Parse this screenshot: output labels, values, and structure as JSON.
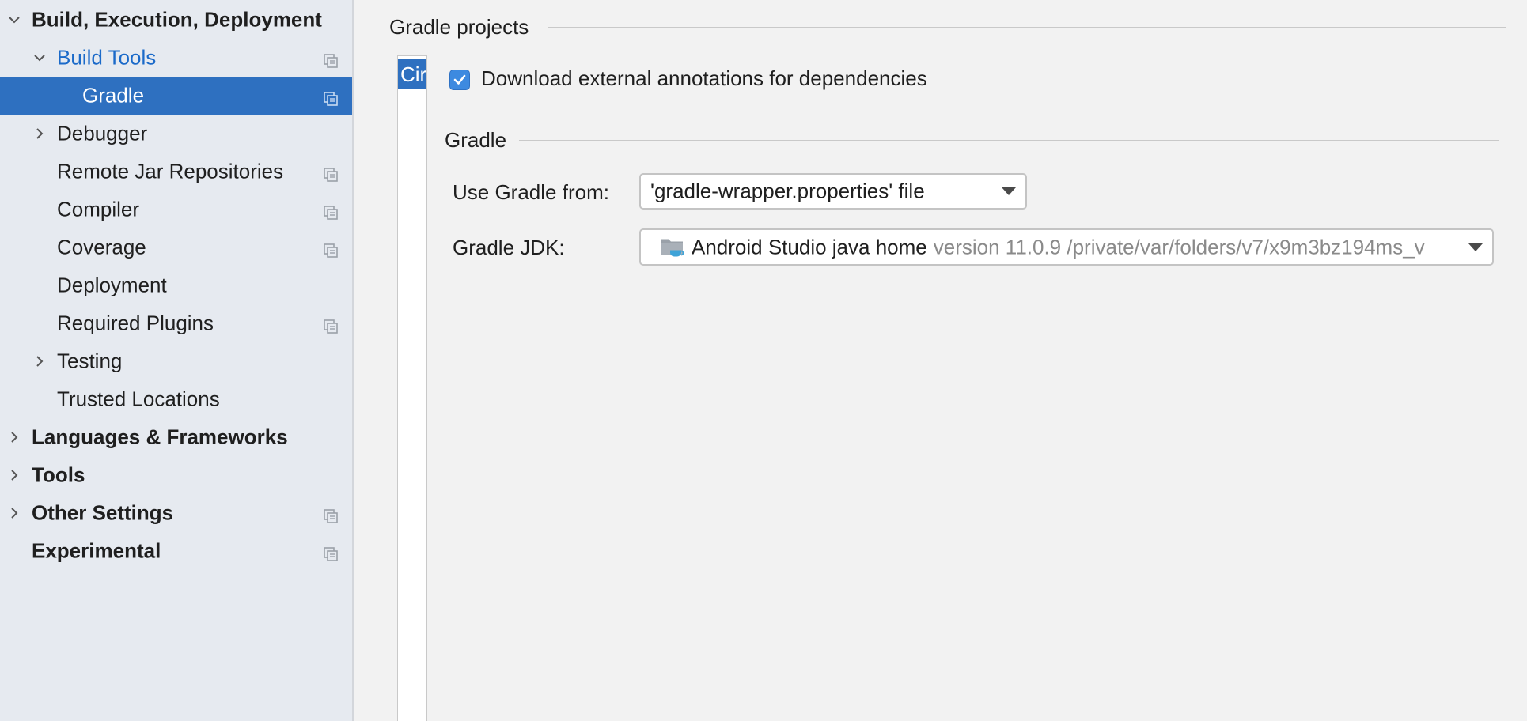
{
  "sidebar": {
    "items": [
      {
        "label": "Build, Execution, Deployment",
        "expanded": true
      },
      {
        "label": "Build Tools",
        "expanded": true
      },
      {
        "label": "Gradle",
        "selected": true
      },
      {
        "label": "Debugger",
        "expanded": false
      },
      {
        "label": "Remote Jar Repositories"
      },
      {
        "label": "Compiler"
      },
      {
        "label": "Coverage"
      },
      {
        "label": "Deployment"
      },
      {
        "label": "Required Plugins"
      },
      {
        "label": "Testing",
        "expanded": false
      },
      {
        "label": "Trusted Locations"
      },
      {
        "label": "Languages & Frameworks",
        "expanded": false
      },
      {
        "label": "Tools",
        "expanded": false
      },
      {
        "label": "Other Settings",
        "expanded": false
      },
      {
        "label": "Experimental"
      }
    ]
  },
  "main": {
    "gradle_projects_title": "Gradle projects",
    "project_list": {
      "selected_item": "Cir"
    },
    "download_annotations": {
      "label": "Download external annotations for dependencies",
      "checked": true
    },
    "gradle_section_title": "Gradle",
    "use_gradle_from": {
      "label": "Use Gradle from:",
      "value": "'gradle-wrapper.properties' file"
    },
    "gradle_jdk": {
      "label": "Gradle JDK:",
      "name": "Android Studio java home",
      "details": "version 11.0.9 /private/var/folders/v7/x9m3bz194ms_v"
    }
  },
  "colors": {
    "selection": "#2e70c0",
    "active_link": "#1b6ac9",
    "sidebar_bg": "#e6eaf0",
    "panel_bg": "#f2f2f2"
  },
  "icons": {
    "expanded": "chevron-down-icon",
    "collapsed": "chevron-right-icon",
    "project_scope": "copy-icon",
    "jdk": "folder-icon"
  }
}
